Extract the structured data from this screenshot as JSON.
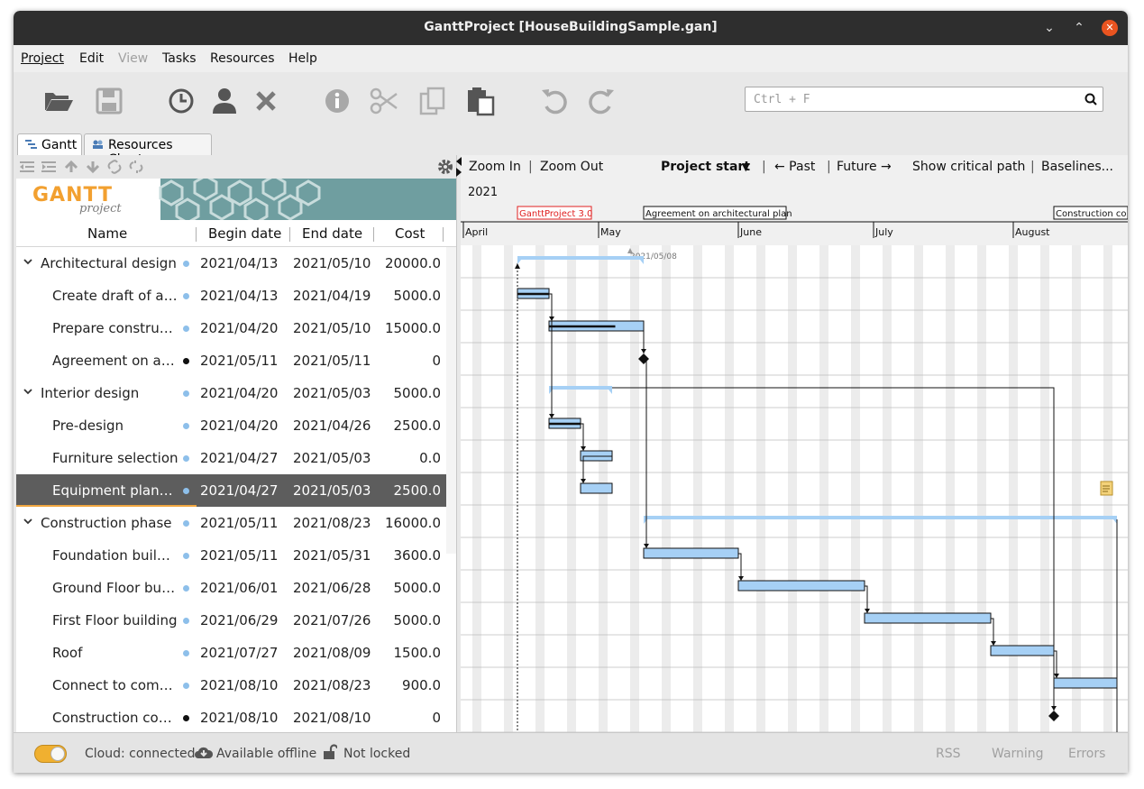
{
  "window": {
    "title": "GanttProject [HouseBuildingSample.gan]"
  },
  "menu": {
    "project": "Project",
    "edit": "Edit",
    "view": "View",
    "tasks": "Tasks",
    "resources": "Resources",
    "help": "Help"
  },
  "search": {
    "placeholder": "Ctrl + F"
  },
  "tabs": {
    "gantt": "Gantt",
    "resources": "Resources Chart"
  },
  "logo": {
    "text": "GANTT",
    "sub": "project"
  },
  "columns": {
    "name": "Name",
    "begin": "Begin date",
    "end": "End date",
    "cost": "Cost"
  },
  "tasks": [
    {
      "name": "Architectural design",
      "begin": "2021/04/13",
      "end": "2021/05/10",
      "cost": "20000.0",
      "group": true,
      "milestone": false
    },
    {
      "name": "Create draft of architecture",
      "begin": "2021/04/13",
      "end": "2021/04/19",
      "cost": "5000.0",
      "group": false,
      "milestone": false
    },
    {
      "name": "Prepare construction documents",
      "begin": "2021/04/20",
      "end": "2021/05/10",
      "cost": "15000.0",
      "group": false,
      "milestone": false
    },
    {
      "name": "Agreement on architectural plan",
      "begin": "2021/05/11",
      "end": "2021/05/11",
      "cost": "0",
      "group": false,
      "milestone": true
    },
    {
      "name": "Interior design",
      "begin": "2021/04/20",
      "end": "2021/05/03",
      "cost": "5000.0",
      "group": true,
      "milestone": false
    },
    {
      "name": "Pre-design",
      "begin": "2021/04/20",
      "end": "2021/04/26",
      "cost": "2500.0",
      "group": false,
      "milestone": false
    },
    {
      "name": "Furniture selection",
      "begin": "2021/04/27",
      "end": "2021/05/03",
      "cost": "0.0",
      "group": false,
      "milestone": false
    },
    {
      "name": "Equipment planning",
      "begin": "2021/04/27",
      "end": "2021/05/03",
      "cost": "2500.0",
      "group": false,
      "milestone": false,
      "selected": true
    },
    {
      "name": "Construction phase",
      "begin": "2021/05/11",
      "end": "2021/08/23",
      "cost": "16000.0",
      "group": true,
      "milestone": false
    },
    {
      "name": "Foundation building",
      "begin": "2021/05/11",
      "end": "2021/05/31",
      "cost": "3600.0",
      "group": false,
      "milestone": false
    },
    {
      "name": "Ground Floor building",
      "begin": "2021/06/01",
      "end": "2021/06/28",
      "cost": "5000.0",
      "group": false,
      "milestone": false
    },
    {
      "name": "First Floor building",
      "begin": "2021/06/29",
      "end": "2021/07/26",
      "cost": "5000.0",
      "group": false,
      "milestone": false
    },
    {
      "name": "Roof",
      "begin": "2021/07/27",
      "end": "2021/08/09",
      "cost": "1500.0",
      "group": false,
      "milestone": false
    },
    {
      "name": "Connect to communications",
      "begin": "2021/08/10",
      "end": "2021/08/23",
      "cost": "900.0",
      "group": false,
      "milestone": false
    },
    {
      "name": "Construction completed",
      "begin": "2021/08/10",
      "end": "2021/08/10",
      "cost": "0",
      "group": false,
      "milestone": true
    }
  ],
  "chart_toolbar": {
    "zoom_in": "Zoom In",
    "zoom_out": "Zoom Out",
    "project_start": "Project start",
    "past": "← Past",
    "future": "Future →",
    "critical": "Show critical path",
    "baselines": "Baselines..."
  },
  "timeline": {
    "year": "2021",
    "months": [
      "April",
      "May",
      "June",
      "July",
      "August"
    ],
    "markers": {
      "gp": "GanttProject 3.0",
      "agreement": "Agreement on architectural plan",
      "construction": "Construction co"
    },
    "today": "2021/05/08"
  },
  "status": {
    "cloud": "Cloud: connected",
    "offline": "Available offline",
    "locked": "Not locked",
    "rss": "RSS",
    "warning": "Warning",
    "errors": "Errors"
  },
  "colors": {
    "bar": "#a6d0f5",
    "selected_row": "#5d5d5d",
    "accent": "#f0a640",
    "titlebar": "#2e2e2e"
  }
}
